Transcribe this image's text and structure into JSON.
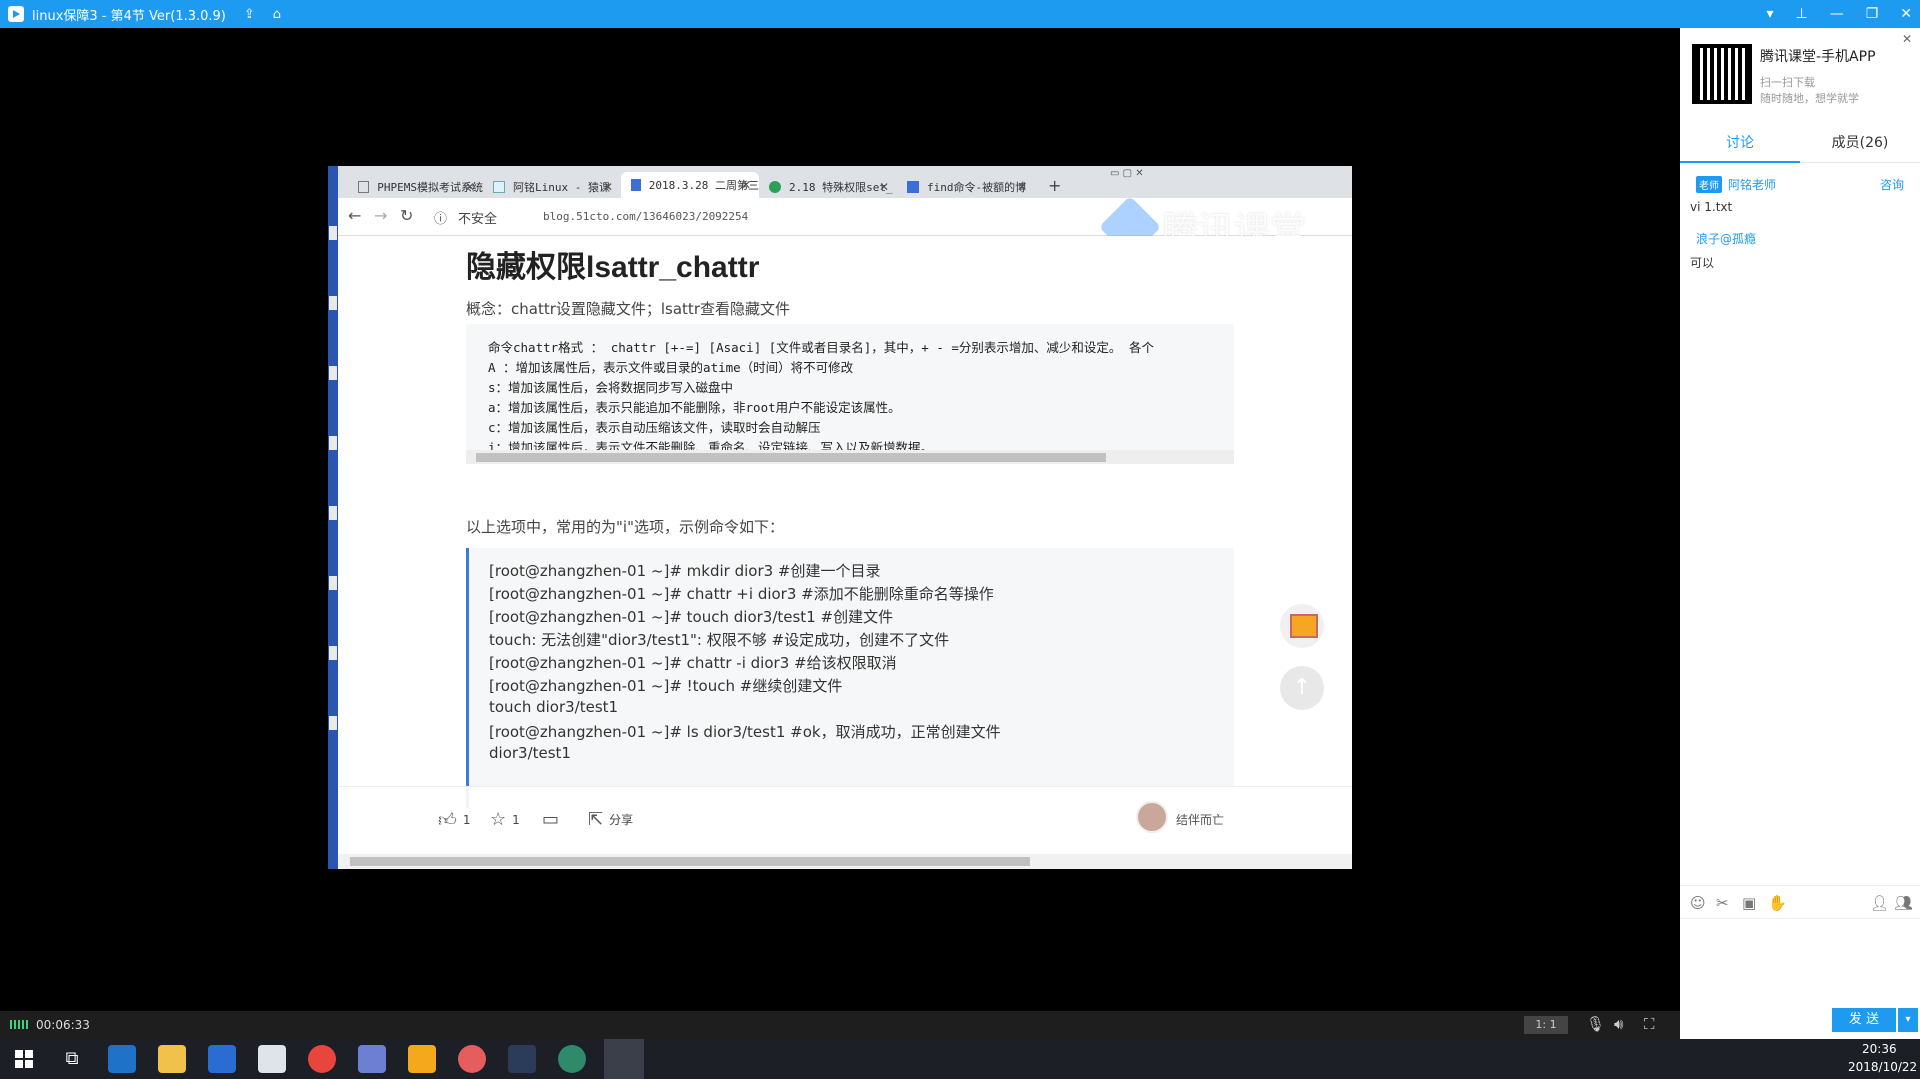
{
  "app": {
    "title": "linux保障3 - 第4节 Ver(1.3.0.9)",
    "controls": [
      "▾",
      "⊥",
      "—",
      "❐",
      "✕"
    ]
  },
  "capture": {
    "tabs": [
      {
        "label": "PHPEMS模拟考试系统",
        "icon": "page-icon"
      },
      {
        "label": "阿铭Linux - 猿课",
        "icon": "site-icon"
      },
      {
        "label": "2018.3.28 二周第三",
        "icon": "blog-icon"
      },
      {
        "label": "2.18 特殊权限set_",
        "icon": "c-icon"
      },
      {
        "label": "find命令-被额的博",
        "icon": "blog-icon"
      }
    ],
    "new_tab": "+",
    "address": {
      "secure_label": "不安全",
      "url": "blog.51cto.com/13646023/2092254"
    },
    "watermark": "腾讯课堂",
    "article": {
      "title": "隐藏权限lsattr_chattr",
      "concept": "概念：chattr设置隐藏文件；lsattr查看隐藏文件",
      "code_lines": [
        "命令chattr格式 ： chattr [+-=] [Asaci] [文件或者目录名]，其中，+ - =分别表示增加、减少和设定。 各个",
        "A ：增加该属性后，表示文件或目录的atime（时间）将不可修改",
        "s：增加该属性后，会将数据同步写入磁盘中",
        "a：增加该属性后，表示只能追加不能删除，非root用户不能设定该属性。",
        "c：增加该属性后，表示自动压缩该文件，读取时会自动解压",
        "i：增加该属性后，表示文件不能删除、重命名、设定链接、写入以及新增数据。"
      ],
      "note": "以上选项中，常用的为\"i\"选项，示例命令如下：",
      "example_lines": [
        "[root@zhangzhen-01 ~]# mkdir dior3 #创建一个目录",
        "[root@zhangzhen-01 ~]# chattr +i dior3 #添加不能删除重命名等操作",
        "[root@zhangzhen-01 ~]# touch dior3/test1 #创建文件",
        "touch: 无法创建\"dior3/test1\": 权限不够 #设定成功，创建不了文件",
        "[root@zhangzhen-01 ~]# chattr -i dior3 #给该权限取消",
        "[root@zhangzhen-01 ~]# !touch #继续创建文件",
        "touch dior3/test1",
        "[root@zhangzhen-01 ~]# ls dior3/test1 #ok，取消成功，正常创建文件",
        "dior3/test1"
      ],
      "footer": {
        "like_count": "1",
        "star_count": "1",
        "share_label": "分享",
        "author": "结伴而亡"
      }
    }
  },
  "panel": {
    "app_title": "腾讯课堂-手机APP",
    "app_sub1": "扫一扫下载",
    "app_sub2": "随时随地，想学就学",
    "tab_discuss": "讨论",
    "tab_members": "成员(26)",
    "messages": [
      {
        "badge": "老师",
        "name": "阿铭老师",
        "action": "咨询",
        "text": "vi 1.txt"
      },
      {
        "badge": "",
        "name": "浪子@孤瘾",
        "action": "",
        "text": "可以"
      }
    ],
    "send_label": "发 送"
  },
  "controlbar": {
    "time": "00:06:33",
    "ratio": "1: 1"
  },
  "taskbar": {
    "time": "20:36",
    "date": "2018/10/22"
  }
}
